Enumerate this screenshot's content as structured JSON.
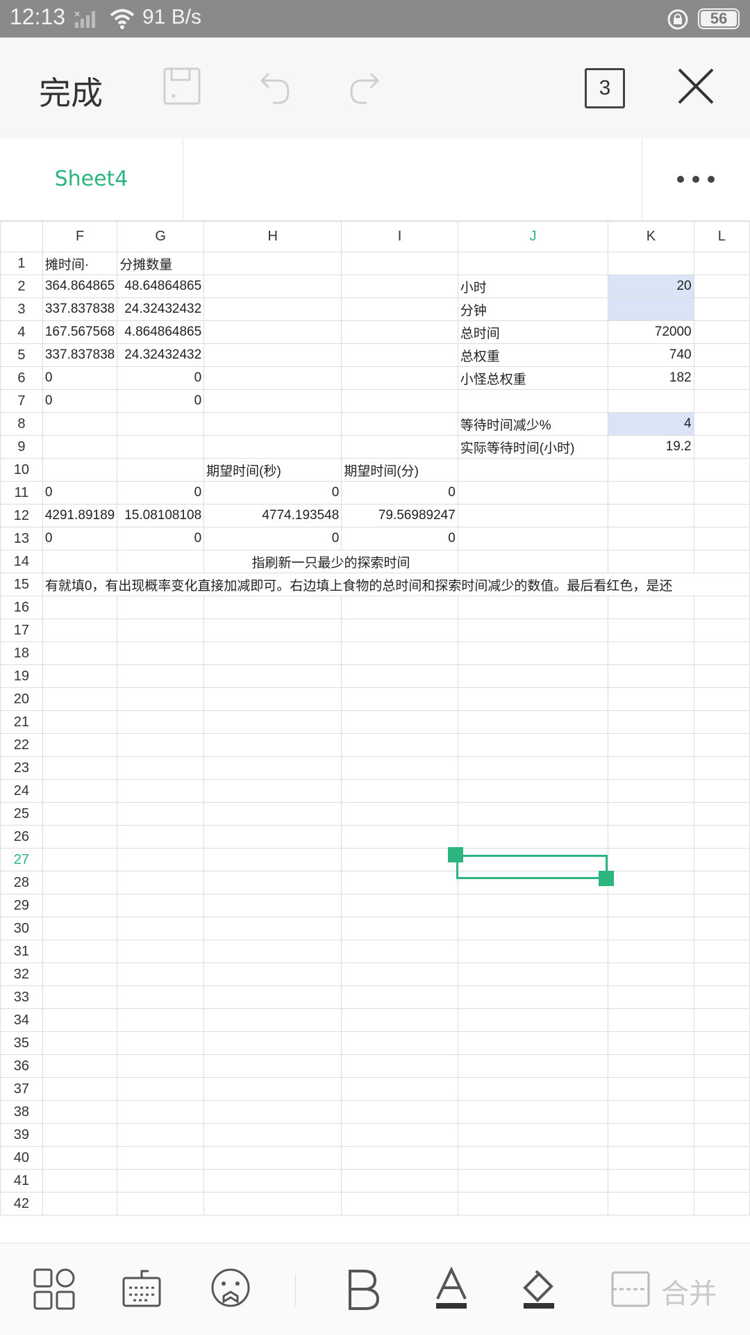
{
  "status": {
    "time": "12:13",
    "net_speed": "91 B/s",
    "battery": "56"
  },
  "toolbar": {
    "done_label": "完成",
    "sheet_count": "3"
  },
  "sheet_tab": {
    "name": "Sheet4"
  },
  "columns": [
    "F",
    "G",
    "H",
    "I",
    "J",
    "K",
    "L"
  ],
  "active_column": "J",
  "active_row": 27,
  "rows": [
    {
      "n": 1,
      "F": "·摊时间",
      "G": "分摊数量",
      "H": "",
      "I": "",
      "J": "",
      "K": ""
    },
    {
      "n": 2,
      "F": "364.864865",
      "G": "48.64864865",
      "H": "",
      "I": "",
      "J": "小时",
      "K": "20"
    },
    {
      "n": 3,
      "F": "337.837838",
      "G": "24.32432432",
      "H": "",
      "I": "",
      "J": "分钟",
      "K": ""
    },
    {
      "n": 4,
      "F": "167.567568",
      "G": "4.864864865",
      "H": "",
      "I": "",
      "J": "总时间",
      "K": "72000"
    },
    {
      "n": 5,
      "F": "337.837838",
      "G": "24.32432432",
      "H": "",
      "I": "",
      "J": "总权重",
      "K": "740"
    },
    {
      "n": 6,
      "F": "0",
      "G": "0",
      "H": "",
      "I": "",
      "J": "小怪总权重",
      "K": "182"
    },
    {
      "n": 7,
      "F": "0",
      "G": "0",
      "H": "",
      "I": "",
      "J": "",
      "K": ""
    },
    {
      "n": 8,
      "F": "",
      "G": "",
      "H": "",
      "I": "",
      "J": "等待时间减少%",
      "K": "4"
    },
    {
      "n": 9,
      "F": "",
      "G": "",
      "H": "",
      "I": "",
      "J": "实际等待时间(小时)",
      "K": "19.2"
    },
    {
      "n": 10,
      "F": "",
      "G": "",
      "H": "期望时间(秒)",
      "I": "期望时间(分)",
      "J": "",
      "K": ""
    },
    {
      "n": 11,
      "F": "0",
      "G": "0",
      "H": "0",
      "I": "0",
      "J": "",
      "K": ""
    },
    {
      "n": 12,
      "F": "4291.89189",
      "G": "15.08108108",
      "H": "4774.193548",
      "I": "79.56989247",
      "J": "",
      "K": ""
    },
    {
      "n": 13,
      "F": "0",
      "G": "0",
      "H": "0",
      "I": "0",
      "J": "",
      "K": ""
    },
    {
      "n": 14,
      "H": "指刷新一只最少的探索时间"
    },
    {
      "n": 15,
      "note": "有就填0，有出现概率变化直接加减即可。右边填上食物的总时间和探索时间减少的数值。最后看红色，是还"
    }
  ],
  "bottom": {
    "merge_label": "合并"
  }
}
